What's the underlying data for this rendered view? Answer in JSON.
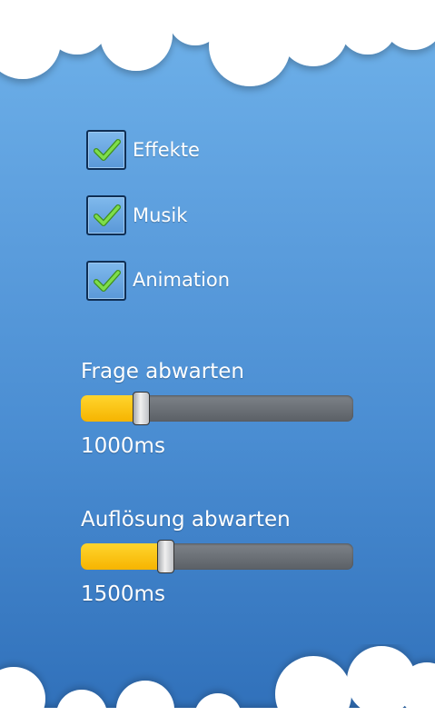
{
  "settings": {
    "checkboxes": [
      {
        "label": "Effekte",
        "checked": true
      },
      {
        "label": "Musik",
        "checked": true
      },
      {
        "label": "Animation",
        "checked": true
      }
    ],
    "sliders": [
      {
        "label": "Frage abwarten",
        "value_text": "1000ms",
        "fraction": 0.22
      },
      {
        "label": "Auflösung abwarten",
        "value_text": "1500ms",
        "fraction": 0.31
      }
    ]
  },
  "colors": {
    "accent": "#f6b400",
    "check": "#6ccd3a",
    "checkbox_border": "#0f2f55"
  },
  "icons": {
    "check": "checkmark-icon",
    "clouds": "cloud-icon"
  }
}
